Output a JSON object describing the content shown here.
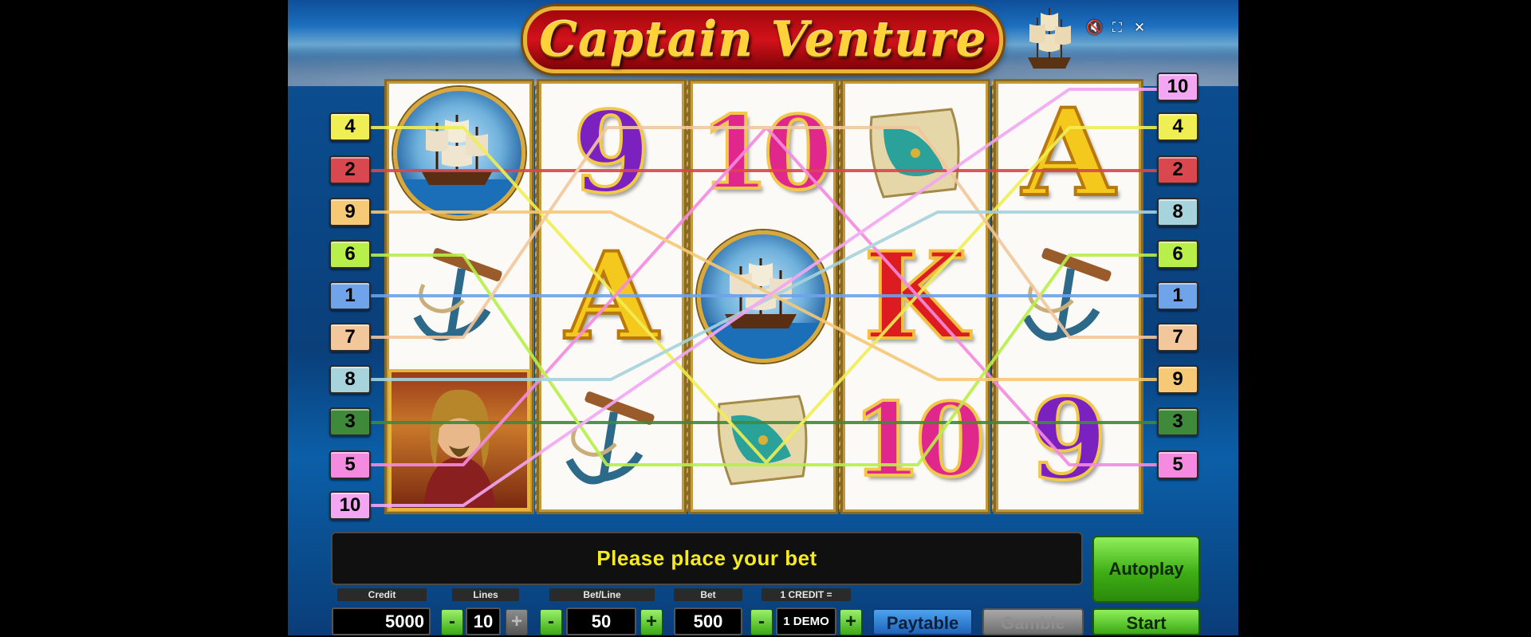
{
  "game": {
    "title": "Captain Venture"
  },
  "top_controls": {
    "sound_icon": "speaker-muted-icon",
    "fullscreen_icon": "fullscreen-icon",
    "close_icon": "close-icon"
  },
  "reels": [
    [
      "ship-medallion",
      "anchor",
      "captain-portrait"
    ],
    [
      "9",
      "A",
      "anchor"
    ],
    [
      "10",
      "ship-medallion",
      "treasure-map"
    ],
    [
      "treasure-map",
      "K",
      "10"
    ],
    [
      "A",
      "anchor",
      "9"
    ]
  ],
  "paylines": {
    "left": [
      "4",
      "2",
      "9",
      "6",
      "1",
      "7",
      "8",
      "3",
      "5",
      "10"
    ],
    "right": [
      "10",
      "4",
      "2",
      "8",
      "6",
      "1",
      "7",
      "9",
      "3",
      "5"
    ],
    "colors": {
      "1": "#6fa3ea",
      "2": "#d9474f",
      "3": "#3f8a3a",
      "4": "#f0ee55",
      "5": "#f58be0",
      "6": "#b8ef4a",
      "7": "#f3c79c",
      "8": "#a7d3dc",
      "9": "#f6c977",
      "10": "#f3a7f3"
    }
  },
  "message": "Please place your bet",
  "autoplay_label": "Autoplay",
  "controls": {
    "credit_label": "Credit",
    "credit_value": "5000",
    "lines_label": "Lines",
    "lines_value": "10",
    "bet_line_label": "Bet/Line",
    "bet_line_value": "50",
    "bet_label": "Bet",
    "bet_value": "500",
    "credit_rate_label": "1 CREDIT =",
    "credit_rate_value": "1 DEMO",
    "minus": "-",
    "plus": "+",
    "paytable_label": "Paytable",
    "gamble_label": "Gamble",
    "start_label": "Start"
  }
}
